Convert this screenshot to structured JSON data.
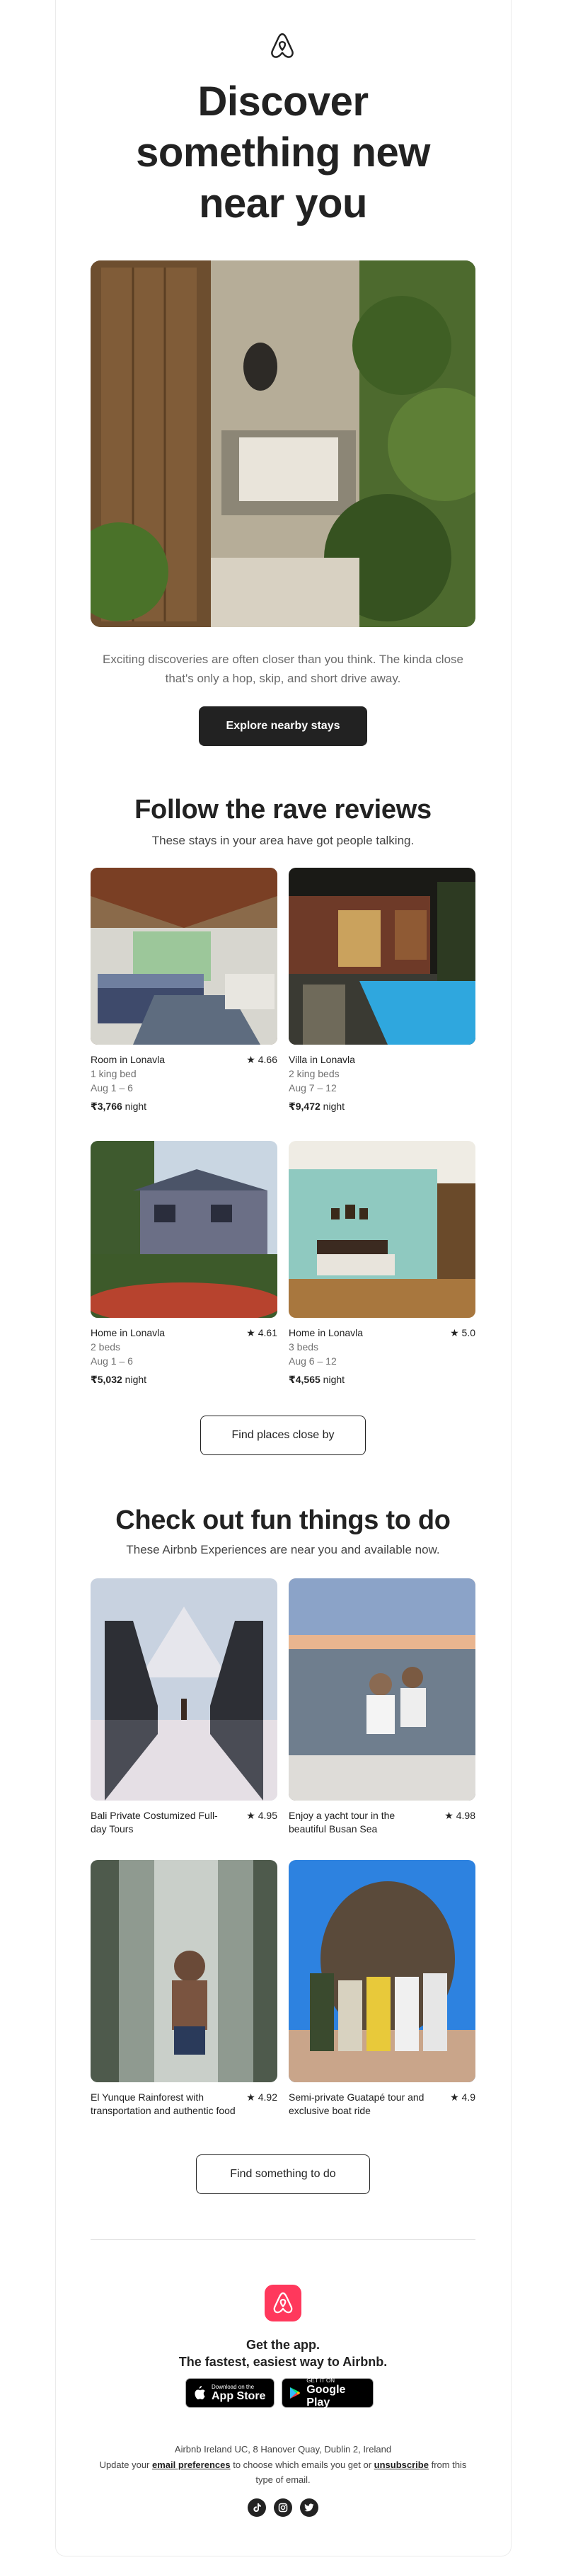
{
  "hero": {
    "title": "Discover something new near you",
    "text": "Exciting discoveries are often closer than you think. The kinda close that's only a hop, skip, and short drive away.",
    "button": "Explore nearby stays"
  },
  "reviews": {
    "title": "Follow the rave reviews",
    "subtitle": "These stays in your area have got people talking.",
    "listings": [
      {
        "title": "Room in Lonavla",
        "rating": "★ 4.66",
        "beds": "1 king bed",
        "dates": "Aug 1 – 6",
        "price": "₹3,766",
        "unit": "night"
      },
      {
        "title": "Villa in Lonavla",
        "rating": "",
        "beds": "2 king beds",
        "dates": "Aug 7 – 12",
        "price": "₹9,472",
        "unit": "night"
      },
      {
        "title": "Home in Lonavla",
        "rating": "★ 4.61",
        "beds": "2 beds",
        "dates": "Aug 1 – 6",
        "price": "₹5,032",
        "unit": "night"
      },
      {
        "title": "Home in Lonavla",
        "rating": "★ 5.0",
        "beds": "3 beds",
        "dates": "Aug 6 – 12",
        "price": "₹4,565",
        "unit": "night"
      }
    ],
    "button": "Find places close by"
  },
  "experiences": {
    "title": "Check out fun things to do",
    "subtitle": "These Airbnb Experiences are near you and available now.",
    "items": [
      {
        "title": "Bali Private Costumized Full-day Tours",
        "rating": "★ 4.95"
      },
      {
        "title": "Enjoy a yacht tour in the beautiful Busan Sea",
        "rating": "★ 4.98"
      },
      {
        "title": "El Yunque Rainforest with transportation and authentic food",
        "rating": "★ 4.92"
      },
      {
        "title": "Semi-private Guatapé tour and exclusive boat ride",
        "rating": "★ 4.9"
      }
    ],
    "button": "Find something to do"
  },
  "footer": {
    "app_title": "Get the app.",
    "app_sub": "The fastest, easiest way to Airbnb.",
    "appstore_small": "Download on the",
    "appstore_big": "App Store",
    "googleplay_small": "GET IT ON",
    "googleplay_big": "Google Play",
    "address": "Airbnb Ireland UC, 8 Hanover Quay, Dublin 2, Ireland",
    "prefs_prefix": "Update your",
    "prefs_link": "email preferences",
    "prefs_middle": "to choose which emails you get or",
    "unsubscribe_link": "unsubscribe",
    "prefs_suffix": "from this type of email."
  },
  "colors": {
    "brand": "#ff385c",
    "text": "#222222",
    "muted": "#717171"
  },
  "icons": [
    "airbnb-logo-icon",
    "tiktok-icon",
    "instagram-icon",
    "twitter-icon",
    "apple-icon",
    "google-play-icon"
  ]
}
